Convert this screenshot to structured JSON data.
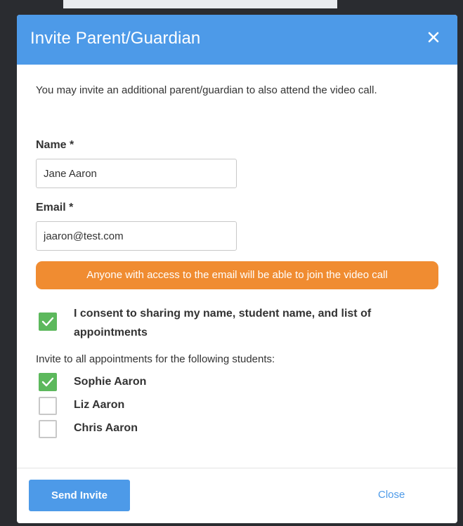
{
  "dialog": {
    "title": "Invite Parent/Guardian",
    "intro": "You may invite an additional parent/guardian to also attend the video call."
  },
  "form": {
    "name_label": "Name *",
    "name_value": "Jane Aaron",
    "email_label": "Email *",
    "email_value": "jaaron@test.com",
    "warning": "Anyone with access to the email will be able to join the video call",
    "consent_text": "I consent to sharing my name, student name, and list of appointments",
    "consent_checked": true,
    "invite_label": "Invite to all appointments for the following students:",
    "students": [
      {
        "name": "Sophie Aaron",
        "checked": true
      },
      {
        "name": "Liz Aaron",
        "checked": false
      },
      {
        "name": "Chris Aaron",
        "checked": false
      }
    ]
  },
  "footer": {
    "send_label": "Send Invite",
    "close_label": "Close"
  },
  "colors": {
    "header": "#4d9ae8",
    "warning": "#f08c31",
    "checkbox_checked": "#5cb85c"
  }
}
